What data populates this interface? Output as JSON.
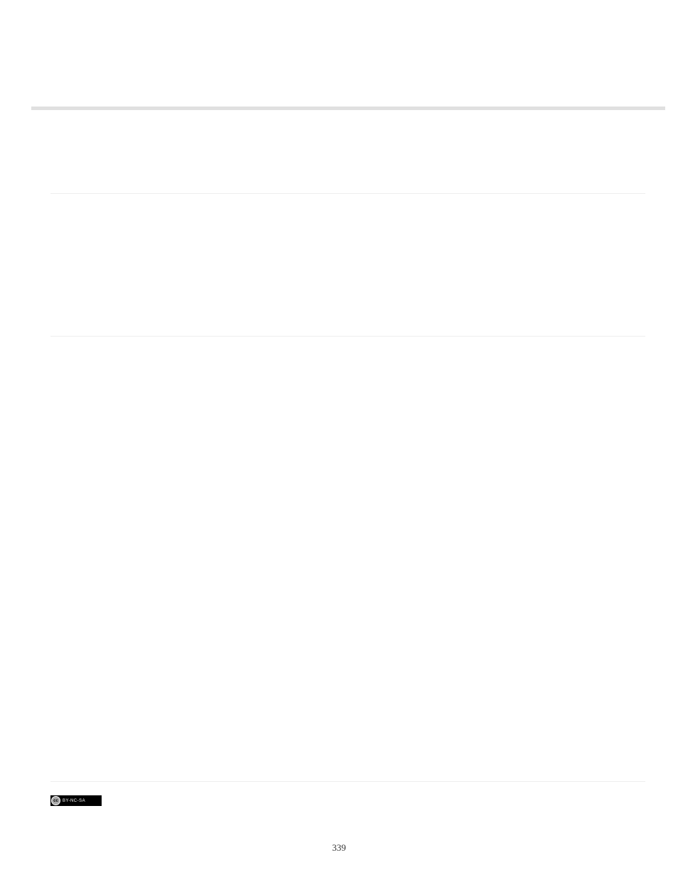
{
  "page": {
    "number": "339"
  },
  "license": {
    "cc_symbol": "cc",
    "text": "BY-NC-SA"
  }
}
